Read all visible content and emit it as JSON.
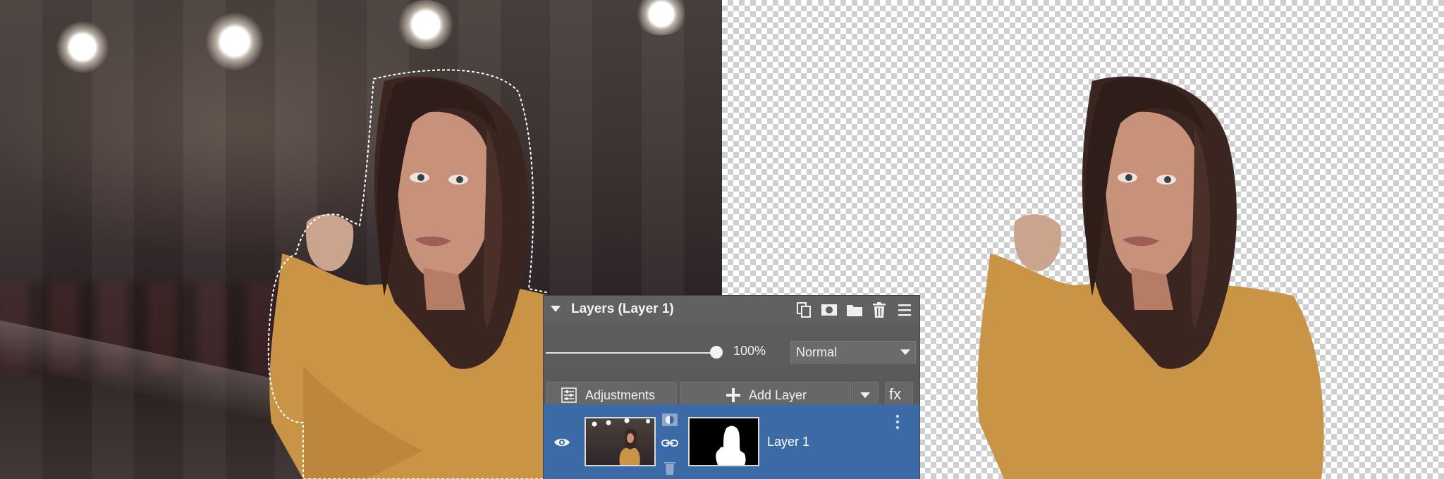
{
  "layers_panel": {
    "title": "Layers (Layer 1)",
    "opacity_value": "100%",
    "opacity_fraction": 1.0,
    "blend_mode": "Normal",
    "adjustments_label": "Adjustments",
    "add_layer_label": "Add Layer",
    "fx_label": "fx",
    "layers": [
      {
        "name": "Layer 1",
        "visible": true,
        "selected": true
      }
    ],
    "header_icons": [
      "duplicate-layer-icon",
      "add-mask-icon",
      "group-folder-icon",
      "delete-layer-icon",
      "panel-menu-icon"
    ],
    "colors": {
      "panel_bg": "#5c5c5c",
      "selected_row": "#3b6aa6"
    }
  }
}
